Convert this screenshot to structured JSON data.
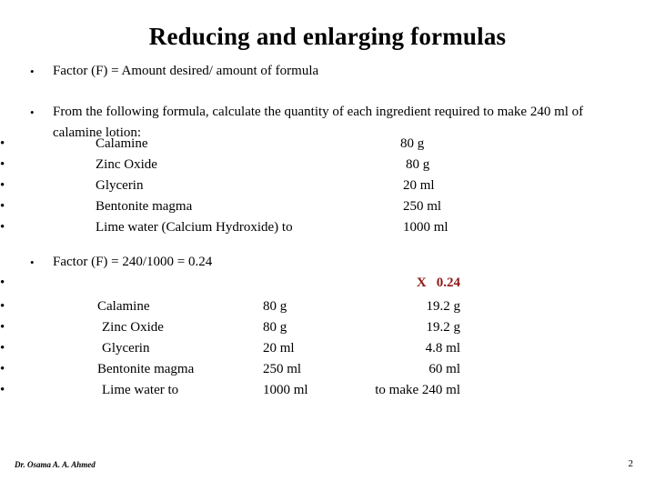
{
  "slide": {
    "title": "Reducing and enlarging formulas",
    "bullet_glyph": "•"
  },
  "intro": {
    "factor_definition": "Factor (F) = Amount desired/ amount of formula",
    "problem_statement": "From the following formula, calculate the quantity of each ingredient required to make 240 ml of calamine lotion:"
  },
  "formula_table": {
    "rows": [
      {
        "name": "Calamine",
        "qty": "80 g"
      },
      {
        "name": "Zinc Oxide",
        "qty": "80 g"
      },
      {
        "name": "Glycerin",
        "qty": "20 ml"
      },
      {
        "name": "Bentonite magma",
        "qty": "250 ml"
      },
      {
        "name": "Lime water (Calcium Hydroxide)  to",
        "qty": "1000 ml"
      }
    ]
  },
  "calculation": {
    "factor_line": "Factor (F) = 240/1000 = 0.24",
    "multiplier_symbol": "X",
    "multiplier_value": "0.24",
    "multiplier_color": "#8C1A18",
    "rows": [
      {
        "name": "Calamine",
        "base": "80 g",
        "result": "19.2 g"
      },
      {
        "name": "Zinc Oxide",
        "base": "80 g",
        "result": "19.2 g"
      },
      {
        "name": "Glycerin",
        "base": "20 ml",
        "result": "4.8 ml"
      },
      {
        "name": "Bentonite magma",
        "base": "250 ml",
        "result": "60 ml"
      },
      {
        "name": "Lime water   to",
        "base": "1000 ml",
        "result": "to make 240 ml"
      }
    ]
  },
  "footer": {
    "author": "Dr. Osama A. A. Ahmed",
    "page_number": "2"
  }
}
